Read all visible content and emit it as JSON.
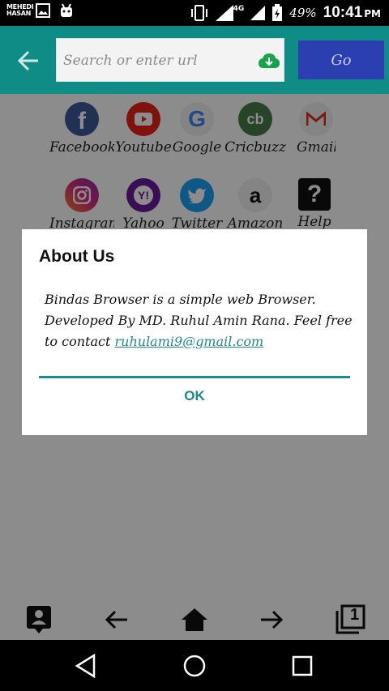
{
  "status_bar": {
    "owner_line1": "MEHEDI",
    "owner_line2": "HASAN",
    "network": "4G",
    "battery_percent": "49%",
    "time": "10:41",
    "ampm": "PM"
  },
  "app_bar": {
    "search_placeholder": "Search or enter url",
    "go_label": "Go"
  },
  "shortcuts": [
    {
      "label": "Facebook",
      "color": "#3b5998"
    },
    {
      "label": "Youtube",
      "color": "#e62117"
    },
    {
      "label": "Google",
      "color": "#f1f1f1"
    },
    {
      "label": "Cricbuzz",
      "color": "#4a7c45"
    },
    {
      "label": "Gmail",
      "color": "#f1f1f1"
    },
    {
      "label": "Instagram",
      "color": "#c13584"
    },
    {
      "label": "Yahoo",
      "color": "#6a1b9a"
    },
    {
      "label": "Twitter",
      "color": "#1da1f2"
    },
    {
      "label": "Amazon",
      "color": "#f1f1f1"
    },
    {
      "label": "Help",
      "color": "#111111"
    }
  ],
  "dialog": {
    "title": "About Us",
    "message": "Bindas Browser is a simple web Browser. Developed By MD. Ruhul Amin Rana. Feel free to contact ",
    "email": "ruhulami9@gmail.com",
    "ok_label": "OK"
  },
  "toolbar": {
    "tab_count": "1"
  },
  "colors": {
    "accent": "#0f8c86",
    "go_button": "#2b3fb0",
    "dialog_accent": "#1a8d86"
  }
}
